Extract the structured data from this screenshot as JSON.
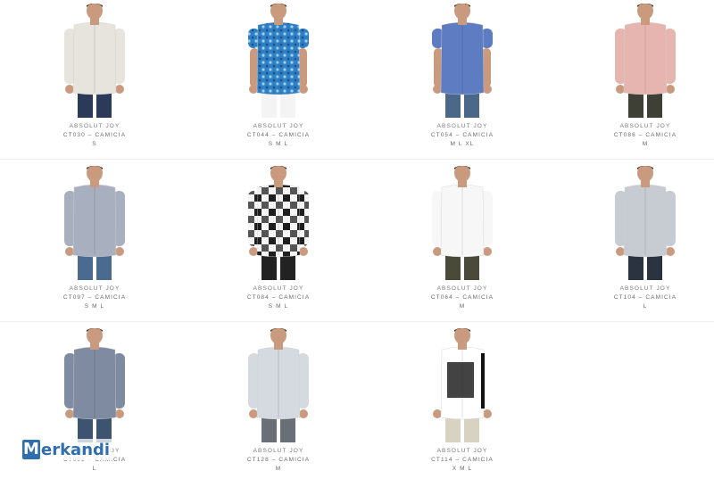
{
  "products": [
    {
      "brand": "ABSOLUT JOY",
      "code": "CT030 – CAMICIA",
      "sizes": "S",
      "shirt": "#e7e3dd",
      "pattern": "plain",
      "pants": "#2b3a59",
      "sleeve": "long"
    },
    {
      "brand": "ABSOLUT JOY",
      "code": "CT044 – CAMICIA",
      "sizes": "S M L",
      "shirt": "#3a86c9",
      "pattern": "floral",
      "pants": "#f4f4f4",
      "sleeve": "short"
    },
    {
      "brand": "ABSOLUT JOY",
      "code": "CT054 – CAMICIA",
      "sizes": "M L XL",
      "shirt": "#5d7cc2",
      "pattern": "plain",
      "pants": "#4c6888",
      "sleeve": "short"
    },
    {
      "brand": "ABSOLUT JOY",
      "code": "CT086 – CAMICIA",
      "sizes": "M",
      "shirt": "#e7b5b0",
      "pattern": "plain",
      "pants": "#3e3f35",
      "sleeve": "roll"
    },
    {
      "brand": "ABSOLUT JOY",
      "code": "CT097 – CAMICIA",
      "sizes": "S M L",
      "shirt": "#a8b0c0",
      "pattern": "plain",
      "pants": "#4a6a90",
      "sleeve": "long"
    },
    {
      "brand": "ABSOLUT JOY",
      "code": "CT084 – CAMICIA",
      "sizes": "S M L",
      "shirt": "#ffffff",
      "pattern": "check",
      "pants": "#222222",
      "sleeve": "long"
    },
    {
      "brand": "ABSOLUT JOY",
      "code": "CT064 – CAMICIA",
      "sizes": "M",
      "shirt": "#f7f7f7",
      "pattern": "plain",
      "pants": "#4a4a3a",
      "sleeve": "long"
    },
    {
      "brand": "ABSOLUT JOY",
      "code": "CT104 – CAMICIA",
      "sizes": "L",
      "shirt": "#c7cbd2",
      "pattern": "plain",
      "pants": "#2c3340",
      "sleeve": "long"
    },
    {
      "brand": "ABSOLUT JOY",
      "code": "CT092 – CAMICIA",
      "sizes": "L",
      "shirt": "#7f8ba0",
      "pattern": "plain",
      "pants": "#3d5470",
      "sleeve": "long"
    },
    {
      "brand": "ABSOLUT JOY",
      "code": "CT128 – CAMICIA",
      "sizes": "M",
      "shirt": "#d5d9e0",
      "pattern": "plain",
      "pants": "#6a6f76",
      "sleeve": "long"
    },
    {
      "brand": "ABSOLUT JOY",
      "code": "CT114 – CAMICIA",
      "sizes": "X M L",
      "shirt": "#ffffff",
      "pattern": "print",
      "pants": "#d8d2c2",
      "sleeve": "long"
    }
  ],
  "watermark": {
    "m": "M",
    "rest": "erkandi"
  }
}
